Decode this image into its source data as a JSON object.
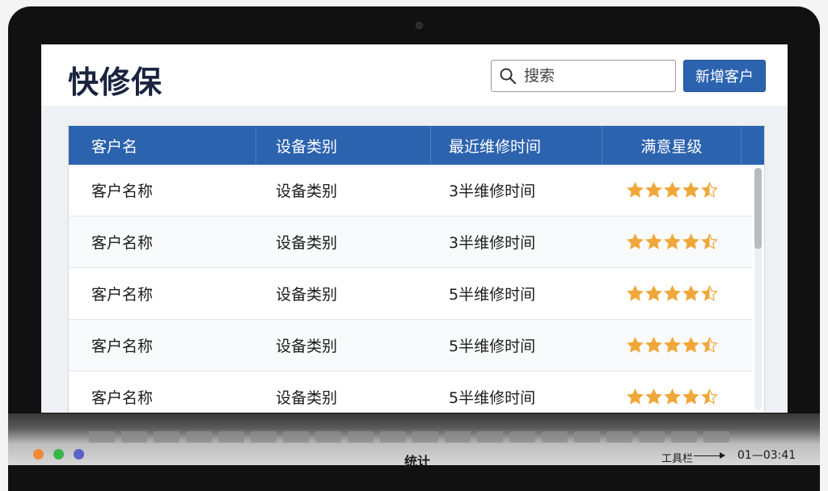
{
  "app": {
    "title": "快修保",
    "search_placeholder": "搜索",
    "add_customer_label": "新增客户"
  },
  "table": {
    "columns": [
      "客户名",
      "设备类别",
      "最近维修时间",
      "满意星级"
    ],
    "rows": [
      {
        "name": "客户名称",
        "category": "设备类别",
        "last_repair": "3半维修时间",
        "rating": 4.5
      },
      {
        "name": "客户名称",
        "category": "设备类别",
        "last_repair": "3半维修时间",
        "rating": 4.5
      },
      {
        "name": "客户名称",
        "category": "设备类别",
        "last_repair": "5半维修时间",
        "rating": 4.5
      },
      {
        "name": "客户名称",
        "category": "设备类别",
        "last_repair": "5半维修时间",
        "rating": 4.5
      },
      {
        "name": "客户名称",
        "category": "设备类别",
        "last_repair": "5半维修时间",
        "rating": 4.5
      }
    ],
    "scroll_position": 0
  },
  "taskbar": {
    "title": "统计",
    "tools_label": "工具栏",
    "time": "01—03:41"
  },
  "colors": {
    "accent": "#2c63ae",
    "star": "#f0a73a",
    "star_empty": "#c8c8c8",
    "window_dot_1": "#f08a3a",
    "window_dot_2": "#3bb54a",
    "window_dot_3": "#5b62c9"
  }
}
